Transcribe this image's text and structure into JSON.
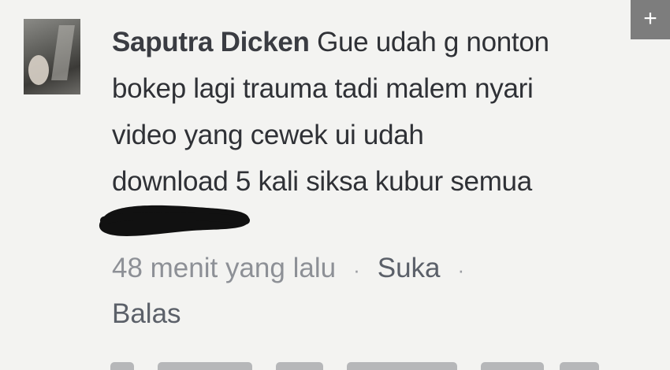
{
  "comment": {
    "author": "Saputra Dicken",
    "lines": [
      "Gue udah g nonton",
      "bokep lagi trauma tadi malem nyari",
      "video yang cewek ui udah",
      "download 5 kali siksa kubur semua"
    ]
  },
  "meta": {
    "time": "48 menit yang lalu",
    "separator": "·",
    "like_label": "Suka",
    "reply_label": "Balas"
  },
  "overlay": {
    "plus_label": "+"
  },
  "colors": {
    "background": "#f3f3f1",
    "text": "#2f3136",
    "meta_text": "#8d9096",
    "redaction": "#111111",
    "overlay_button": "#7d7d7d"
  },
  "icons": {
    "avatar": "profile-photo",
    "overlay": "plus-icon"
  }
}
